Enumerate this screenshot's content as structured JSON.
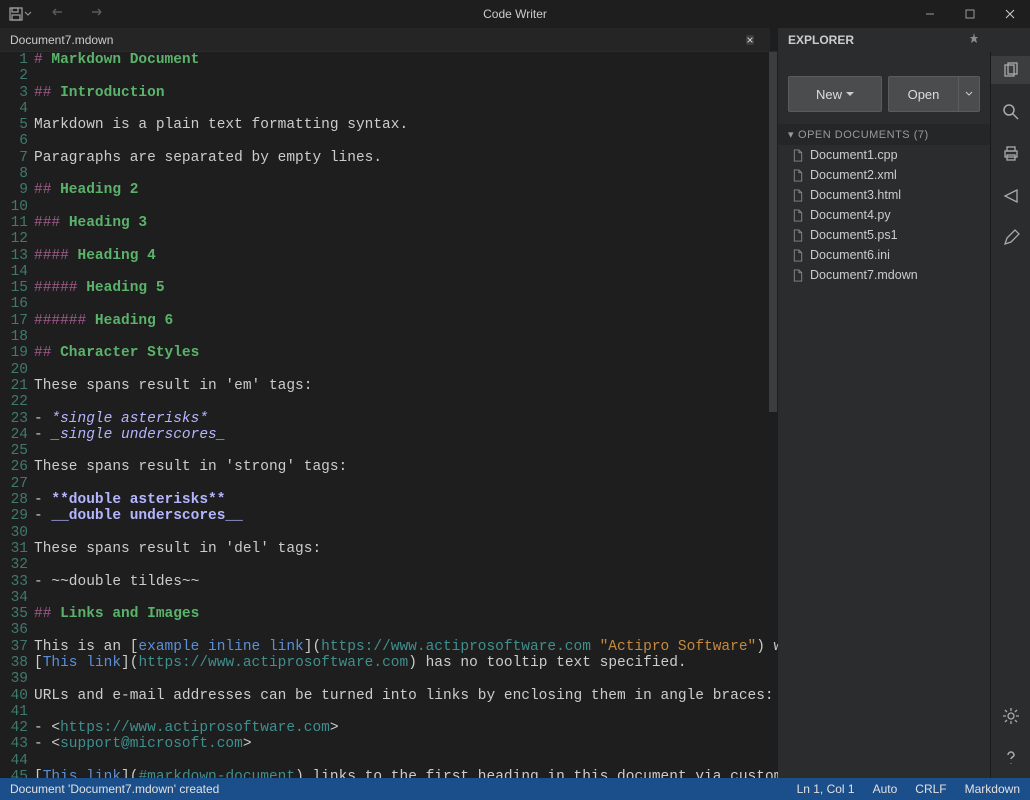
{
  "app_title": "Code Writer",
  "tab": {
    "label": "Document7.mdown"
  },
  "explorer": {
    "title": "EXPLORER",
    "new_label": "New",
    "open_label": "Open",
    "section_label": "OPEN DOCUMENTS (7)",
    "documents": [
      "Document1.cpp",
      "Document2.xml",
      "Document3.html",
      "Document4.py",
      "Document5.ps1",
      "Document6.ini",
      "Document7.mdown"
    ]
  },
  "editor": {
    "lines": [
      {
        "n": 1,
        "tokens": [
          [
            "# ",
            "punct"
          ],
          [
            "Markdown Document",
            "head"
          ]
        ]
      },
      {
        "n": 2,
        "tokens": []
      },
      {
        "n": 3,
        "tokens": [
          [
            "## ",
            "punct"
          ],
          [
            "Introduction",
            "head"
          ]
        ]
      },
      {
        "n": 4,
        "tokens": []
      },
      {
        "n": 5,
        "tokens": [
          [
            "Markdown is a plain text formatting syntax.",
            ""
          ]
        ]
      },
      {
        "n": 6,
        "tokens": []
      },
      {
        "n": 7,
        "tokens": [
          [
            "Paragraphs are separated by empty lines.",
            ""
          ]
        ]
      },
      {
        "n": 8,
        "tokens": []
      },
      {
        "n": 9,
        "tokens": [
          [
            "## ",
            "punct"
          ],
          [
            "Heading 2",
            "head"
          ]
        ]
      },
      {
        "n": 10,
        "tokens": []
      },
      {
        "n": 11,
        "tokens": [
          [
            "### ",
            "punct"
          ],
          [
            "Heading 3",
            "head"
          ]
        ]
      },
      {
        "n": 12,
        "tokens": []
      },
      {
        "n": 13,
        "tokens": [
          [
            "#### ",
            "punct"
          ],
          [
            "Heading 4",
            "head"
          ]
        ]
      },
      {
        "n": 14,
        "tokens": []
      },
      {
        "n": 15,
        "tokens": [
          [
            "##### ",
            "punct"
          ],
          [
            "Heading 5",
            "head"
          ]
        ]
      },
      {
        "n": 16,
        "tokens": []
      },
      {
        "n": 17,
        "tokens": [
          [
            "###### ",
            "punct"
          ],
          [
            "Heading 6",
            "head"
          ]
        ]
      },
      {
        "n": 18,
        "tokens": []
      },
      {
        "n": 19,
        "tokens": [
          [
            "## ",
            "punct"
          ],
          [
            "Character Styles",
            "head"
          ]
        ]
      },
      {
        "n": 20,
        "tokens": []
      },
      {
        "n": 21,
        "tokens": [
          [
            "These spans result in 'em' tags:",
            ""
          ]
        ]
      },
      {
        "n": 22,
        "tokens": []
      },
      {
        "n": 23,
        "tokens": [
          [
            "- ",
            ""
          ],
          [
            "*single asterisks*",
            "em"
          ]
        ]
      },
      {
        "n": 24,
        "tokens": [
          [
            "- ",
            ""
          ],
          [
            "_single underscores_",
            "em"
          ]
        ]
      },
      {
        "n": 25,
        "tokens": []
      },
      {
        "n": 26,
        "tokens": [
          [
            "These spans result in 'strong' tags:",
            ""
          ]
        ]
      },
      {
        "n": 27,
        "tokens": []
      },
      {
        "n": 28,
        "tokens": [
          [
            "- ",
            ""
          ],
          [
            "**double asterisks**",
            "strong"
          ]
        ]
      },
      {
        "n": 29,
        "tokens": [
          [
            "- ",
            ""
          ],
          [
            "__double underscores__",
            "strong"
          ]
        ]
      },
      {
        "n": 30,
        "tokens": []
      },
      {
        "n": 31,
        "tokens": [
          [
            "These spans result in 'del' tags:",
            ""
          ]
        ]
      },
      {
        "n": 32,
        "tokens": []
      },
      {
        "n": 33,
        "tokens": [
          [
            "- ~~double tildes~~",
            ""
          ]
        ]
      },
      {
        "n": 34,
        "tokens": []
      },
      {
        "n": 35,
        "tokens": [
          [
            "## ",
            "punct"
          ],
          [
            "Links and Images",
            "head"
          ]
        ]
      },
      {
        "n": 36,
        "tokens": []
      },
      {
        "n": 37,
        "tokens": [
          [
            "This is an [",
            ""
          ],
          [
            "example inline link",
            "link-text"
          ],
          [
            "](",
            ""
          ],
          [
            "https://www.actiprosoftware.com",
            "link-url"
          ],
          [
            " ",
            ""
          ],
          [
            "\"Actipro Software\"",
            "link-title"
          ],
          [
            ") with tooltip",
            ""
          ]
        ]
      },
      {
        "n": 38,
        "tokens": [
          [
            "[",
            ""
          ],
          [
            "This link",
            "link-text"
          ],
          [
            "](",
            ""
          ],
          [
            "https://www.actiprosoftware.com",
            "link-url"
          ],
          [
            ") has no tooltip text specified.",
            ""
          ]
        ]
      },
      {
        "n": 39,
        "tokens": []
      },
      {
        "n": 40,
        "tokens": [
          [
            "URLs and e-mail addresses can be turned into links by enclosing them in angle braces:",
            ""
          ]
        ]
      },
      {
        "n": 41,
        "tokens": []
      },
      {
        "n": 42,
        "tokens": [
          [
            "- <",
            ""
          ],
          [
            "https://www.actiprosoftware.com",
            "link-url"
          ],
          [
            ">",
            ""
          ]
        ]
      },
      {
        "n": 43,
        "tokens": [
          [
            "- <",
            ""
          ],
          [
            "support@microsoft.com",
            "link-url"
          ],
          [
            ">",
            ""
          ]
        ]
      },
      {
        "n": 44,
        "tokens": []
      },
      {
        "n": 45,
        "tokens": [
          [
            "[",
            ""
          ],
          [
            "This link",
            "link-text"
          ],
          [
            "](",
            ""
          ],
          [
            "#markdown-document",
            "link-url"
          ],
          [
            ") links to the first heading in this document via custom ID.",
            ""
          ]
        ]
      }
    ]
  },
  "status": {
    "left": "Document 'Document7.mdown' created",
    "position": "Ln 1, Col 1",
    "encoding": "Auto",
    "line_ending": "CRLF",
    "language": "Markdown"
  }
}
